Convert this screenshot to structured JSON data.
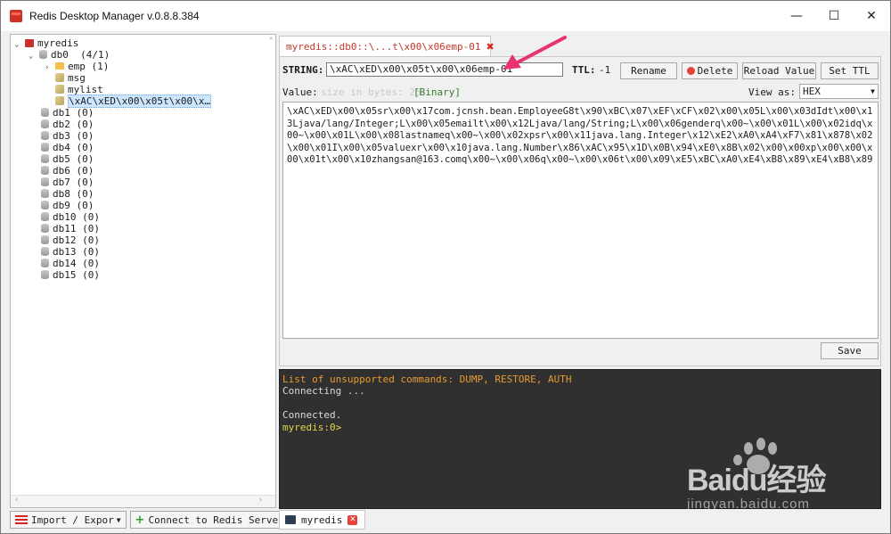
{
  "window": {
    "title": "Redis Desktop Manager v.0.8.8.384",
    "minimize": "—",
    "maximize": "☐",
    "close": "✕"
  },
  "tree": {
    "server": "myredis",
    "db0": {
      "label": "db0",
      "count": "(4/1)"
    },
    "keys": [
      {
        "label": "emp",
        "count": "(1)"
      },
      {
        "label": "msg"
      },
      {
        "label": "mylist"
      },
      {
        "label": "\\xAC\\xED\\x00\\x05t\\x00\\x…"
      }
    ],
    "dbs": [
      {
        "label": "db1",
        "count": "(0)"
      },
      {
        "label": "db2",
        "count": "(0)"
      },
      {
        "label": "db3",
        "count": "(0)"
      },
      {
        "label": "db4",
        "count": "(0)"
      },
      {
        "label": "db5",
        "count": "(0)"
      },
      {
        "label": "db6",
        "count": "(0)"
      },
      {
        "label": "db7",
        "count": "(0)"
      },
      {
        "label": "db8",
        "count": "(0)"
      },
      {
        "label": "db9",
        "count": "(0)"
      },
      {
        "label": "db10",
        "count": "(0)"
      },
      {
        "label": "db11",
        "count": "(0)"
      },
      {
        "label": "db12",
        "count": "(0)"
      },
      {
        "label": "db13",
        "count": "(0)"
      },
      {
        "label": "db14",
        "count": "(0)"
      },
      {
        "label": "db15",
        "count": "(0)"
      }
    ]
  },
  "toolbar": {
    "import_export": "Import / Expor",
    "connect": "Connect to Redis Server"
  },
  "tab": {
    "label": "myredis::db0::\\...t\\x00\\x06emp-01",
    "close": "✖"
  },
  "editor": {
    "type_label": "STRING:",
    "key_value": "\\xAC\\xED\\x00\\x05t\\x00\\x06emp-01",
    "ttl_label": "TTL:",
    "ttl_value": "-1",
    "rename": "Rename",
    "delete": "Delete",
    "reload": "Reload Value",
    "set_ttl": "Set TTL",
    "value_label": "Value:",
    "size_hint": "size in bytes: 25",
    "binary_tag": "[Binary]",
    "view_as_label": "View as:",
    "view_as_value": "HEX",
    "value_text": "\\xAC\\xED\\x00\\x05sr\\x00\\x17com.jcnsh.bean.EmployeeG8t\\x90\\xBC\\x07\\xEF\\xCF\\x02\\x00\\x05L\\x00\\x03dIdt\\x00\\x13Ljava/lang/Integer;L\\x00\\x05emailt\\x00\\x12Ljava/lang/String;L\\x00\\x06genderq\\x00~\\x00\\x01L\\x00\\x02idq\\x00~\\x00\\x01L\\x00\\x08lastnameq\\x00~\\x00\\x02xpsr\\x00\\x11java.lang.Integer\\x12\\xE2\\xA0\\xA4\\xF7\\x81\\x878\\x02\\x00\\x01I\\x00\\x05valuexr\\x00\\x10java.lang.Number\\x86\\xAC\\x95\\x1D\\x0B\\x94\\xE0\\x8B\\x02\\x00\\x00xp\\x00\\x00\\x00\\x01t\\x00\\x10zhangsan@163.comq\\x00~\\x00\\x06q\\x00~\\x00\\x06t\\x00\\x09\\xE5\\xBC\\xA0\\xE4\\xB8\\x89\\xE4\\xB8\\x89",
    "save": "Save"
  },
  "console": {
    "line1": "List of unsupported commands: DUMP, RESTORE, AUTH",
    "line2": "Connecting ...",
    "line3": "Connected.",
    "prompt": "myredis:0>",
    "tab_label": "myredis",
    "tab_close": "✕"
  },
  "watermark": {
    "brand": "Baidu经验",
    "url": "jingyan.baidu.com"
  },
  "colors": {
    "accent_red": "#d9241f",
    "tab_text": "#c0392b",
    "console_bg": "#303030",
    "console_warn": "#e89b2f",
    "console_prompt": "#e7d34a",
    "binary_green": "#2f7d2f",
    "annotation_arrow": "#e8336d"
  }
}
